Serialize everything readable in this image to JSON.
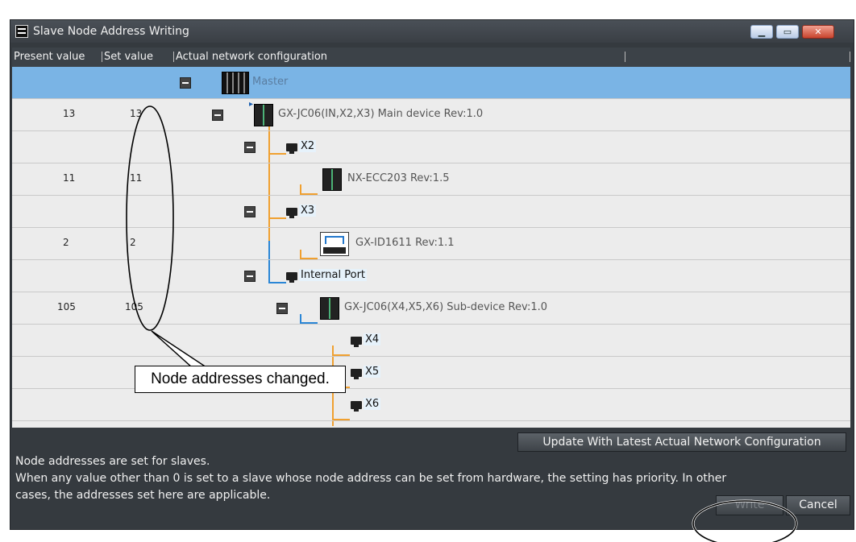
{
  "window": {
    "title": "Slave Node Address Writing"
  },
  "grid": {
    "headers": [
      "Present value",
      "Set value",
      "Actual network configuration"
    ],
    "rows": [
      {
        "present": "",
        "set": "",
        "label": "Master"
      },
      {
        "present": "13",
        "set": "13",
        "label": "GX-JC06(IN,X2,X3) Main device Rev:1.0"
      },
      {
        "present": "",
        "set": "",
        "label": "X2"
      },
      {
        "present": "11",
        "set": "11",
        "label": "NX-ECC203 Rev:1.5"
      },
      {
        "present": "",
        "set": "",
        "label": "X3"
      },
      {
        "present": "2",
        "set": "2",
        "label": "GX-ID1611 Rev:1.1"
      },
      {
        "present": "",
        "set": "",
        "label": "Internal Port"
      },
      {
        "present": "105",
        "set": "105",
        "label": "GX-JC06(X4,X5,X6) Sub-device Rev:1.0"
      },
      {
        "present": "",
        "set": "",
        "label": "X4"
      },
      {
        "present": "",
        "set": "",
        "label": "X5"
      },
      {
        "present": "",
        "set": "",
        "label": "X6"
      }
    ]
  },
  "callout": {
    "text": "Node addresses changed."
  },
  "buttons": {
    "update": "Update With Latest Actual Network Configuration",
    "write": "Write",
    "cancel": "Cancel"
  },
  "description": {
    "line1": "Node addresses are set for slaves.",
    "line2": "When any value other than 0 is set to a slave whose node address can be set from hardware, the setting has priority. In other",
    "line3": "cases, the addresses set here are applicable."
  },
  "colors": {
    "selected_row": "#7ab4e5",
    "tree_orange": "#f0a030",
    "tree_blue": "#2a86d6"
  },
  "icons": [
    "app-icon",
    "minimize-icon",
    "maximize-icon",
    "close-icon",
    "collapse-icon",
    "port-icon",
    "device-icon"
  ]
}
